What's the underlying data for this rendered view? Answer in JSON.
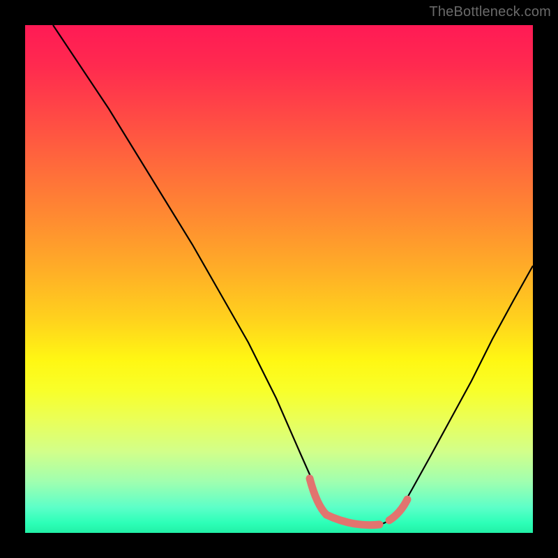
{
  "watermark": "TheBottleneck.com",
  "colors": {
    "page_bg": "#000000",
    "curve": "#000000",
    "highlight": "#e2746f",
    "watermark_text": "#6a6a6a"
  },
  "chart_data": {
    "type": "line",
    "title": "",
    "xlabel": "",
    "ylabel": "",
    "xlim": [
      0,
      100
    ],
    "ylim": [
      0,
      100
    ],
    "x": [
      0,
      5,
      10,
      15,
      20,
      25,
      30,
      35,
      40,
      45,
      50,
      55,
      57,
      60,
      62,
      65,
      68,
      70,
      73,
      75,
      80,
      85,
      90,
      95,
      100
    ],
    "series": [
      {
        "name": "bottleneck-curve",
        "values": [
          100,
          92,
          84,
          76,
          68,
          60,
          52,
          44,
          36,
          28,
          20,
          12,
          8,
          4,
          2,
          1,
          1,
          2,
          5,
          8,
          16,
          25,
          34,
          43,
          52
        ]
      }
    ],
    "highlight_segments": [
      {
        "x_range": [
          55,
          58
        ],
        "y_approx": [
          12,
          5
        ]
      },
      {
        "x_range": [
          58,
          72
        ],
        "y_approx": [
          4,
          4
        ]
      },
      {
        "x_range": [
          72,
          75
        ],
        "y_approx": [
          5,
          8
        ]
      }
    ],
    "gradient_stops": [
      {
        "pct": 0,
        "color": "#ff1a55"
      },
      {
        "pct": 50,
        "color": "#ffd21d"
      },
      {
        "pct": 75,
        "color": "#f8ff2a"
      },
      {
        "pct": 100,
        "color": "#22f0a6"
      }
    ]
  }
}
